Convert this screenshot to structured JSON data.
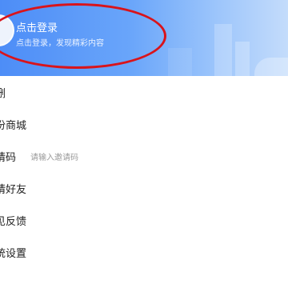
{
  "header": {
    "login_title": "点击登录",
    "login_subtitle": "点击登录，发现精彩内容"
  },
  "menu": {
    "items": [
      {
        "label": "删"
      },
      {
        "label": "份商城"
      },
      {
        "label": "请码",
        "hint": "请输入邀请码"
      },
      {
        "label": "请好友"
      },
      {
        "label": "见反馈"
      },
      {
        "label": "统设置"
      }
    ]
  },
  "colors": {
    "header_gradient_start": "#4d8df7",
    "header_gradient_end": "#c4dcfb",
    "annotation_ellipse": "#d9141b",
    "menu_text": "#222222",
    "hint_text": "#9a9a9a"
  }
}
